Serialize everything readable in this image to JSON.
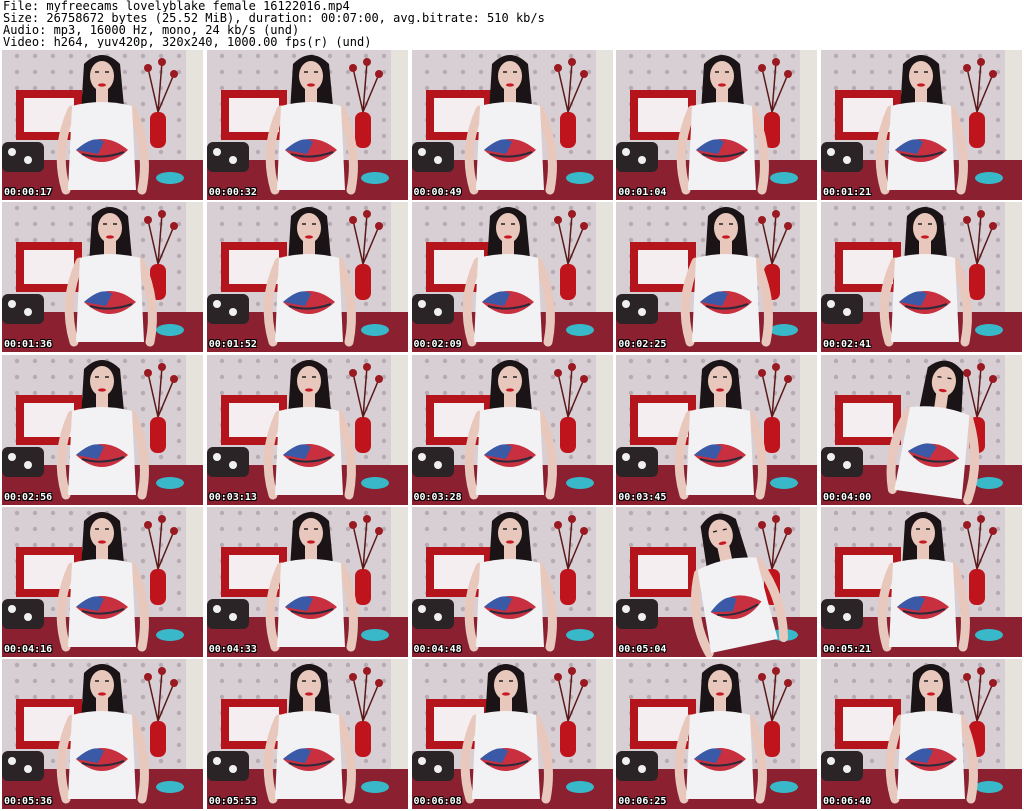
{
  "header": {
    "file_line": "File: myfreecams_lovelyblake_female_16122016.mp4",
    "size_line": "Size: 26758672 bytes (25.52 MiB), duration: 00:07:00, avg.bitrate: 510 kb/s",
    "audio_line": "Audio: mp3, 16000 Hz, mono, 24 kb/s (und)",
    "video_line": "Video: h264, yuv420p, 320x240, 1000.00 fps(r) (und)"
  },
  "thumbnails": [
    {
      "timestamp": "00:00:17"
    },
    {
      "timestamp": "00:00:32"
    },
    {
      "timestamp": "00:00:49"
    },
    {
      "timestamp": "00:01:04"
    },
    {
      "timestamp": "00:01:21"
    },
    {
      "timestamp": "00:01:36"
    },
    {
      "timestamp": "00:01:52"
    },
    {
      "timestamp": "00:02:09"
    },
    {
      "timestamp": "00:02:25"
    },
    {
      "timestamp": "00:02:41"
    },
    {
      "timestamp": "00:02:56"
    },
    {
      "timestamp": "00:03:13"
    },
    {
      "timestamp": "00:03:28"
    },
    {
      "timestamp": "00:03:45"
    },
    {
      "timestamp": "00:04:00"
    },
    {
      "timestamp": "00:04:16"
    },
    {
      "timestamp": "00:04:33"
    },
    {
      "timestamp": "00:04:48"
    },
    {
      "timestamp": "00:05:04"
    },
    {
      "timestamp": "00:05:21"
    },
    {
      "timestamp": "00:05:36"
    },
    {
      "timestamp": "00:05:53"
    },
    {
      "timestamp": "00:06:08"
    },
    {
      "timestamp": "00:06:25"
    },
    {
      "timestamp": "00:06:40"
    }
  ],
  "colors": {
    "wall": "#d8cfd4",
    "headboard": "#b4141c",
    "shirt": "#f2f2f4",
    "hair": "#1a1416",
    "skin": "#e8c8bc",
    "vase": "#c0141c",
    "bedding": "#8a2030",
    "flag_blue": "#3a5aa8",
    "flag_red": "#c83040",
    "accent_teal": "#38b8c8"
  }
}
